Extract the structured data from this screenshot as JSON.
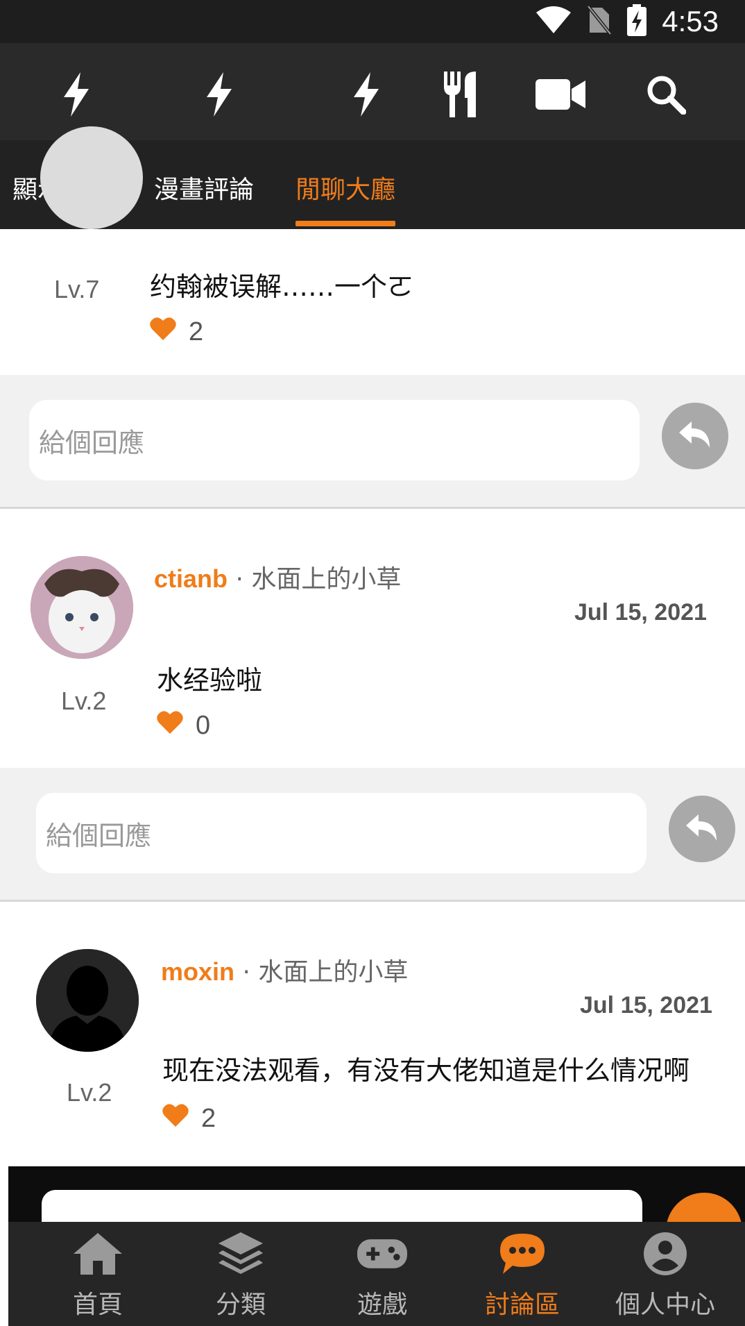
{
  "status_bar": {
    "time": "4:53",
    "icons": [
      "wifi-icon",
      "no-sim-icon",
      "battery-charging-icon"
    ]
  },
  "toolbar": {
    "icons": [
      "flash-icon",
      "flash-icon",
      "flash-icon",
      "utensils-icon",
      "video-camera-icon",
      "search-icon"
    ]
  },
  "tabs": [
    {
      "label": "顯示全部",
      "active": false
    },
    {
      "label": "漫畫評論",
      "active": false
    },
    {
      "label": "閒聊大廳",
      "active": true
    }
  ],
  "comments": [
    {
      "level": "Lv.7",
      "content": "约翰被误解……一个ㄛ",
      "likes": "2",
      "reply_placeholder": "給個回應"
    },
    {
      "author": "ctianb",
      "group": " · 水面上的小草",
      "date": "Jul 15, 2021",
      "level": "Lv.2",
      "content": "水经验啦",
      "likes": "0",
      "reply_placeholder": "給個回應"
    },
    {
      "author": "moxin",
      "group": " · 水面上的小草",
      "date": "Jul 15, 2021",
      "level": "Lv.2",
      "content": "现在没法观看，有没有大佬知道是什么情况啊",
      "likes": "2"
    }
  ],
  "bottom_nav": [
    {
      "label": "首頁",
      "icon": "home-icon",
      "active": false
    },
    {
      "label": "分類",
      "icon": "layers-icon",
      "active": false
    },
    {
      "label": "遊戲",
      "icon": "gamepad-icon",
      "active": false
    },
    {
      "label": "討論區",
      "icon": "chat-bubble-icon",
      "active": true
    },
    {
      "label": "個人中心",
      "icon": "user-profile-icon",
      "active": false
    }
  ],
  "colors": {
    "accent": "#f07c1a",
    "tab_bar": "#222222",
    "toolbar": "#2a2a2a",
    "reply_bg": "#f1f1f1",
    "reply_button": "#a9a9a9"
  }
}
